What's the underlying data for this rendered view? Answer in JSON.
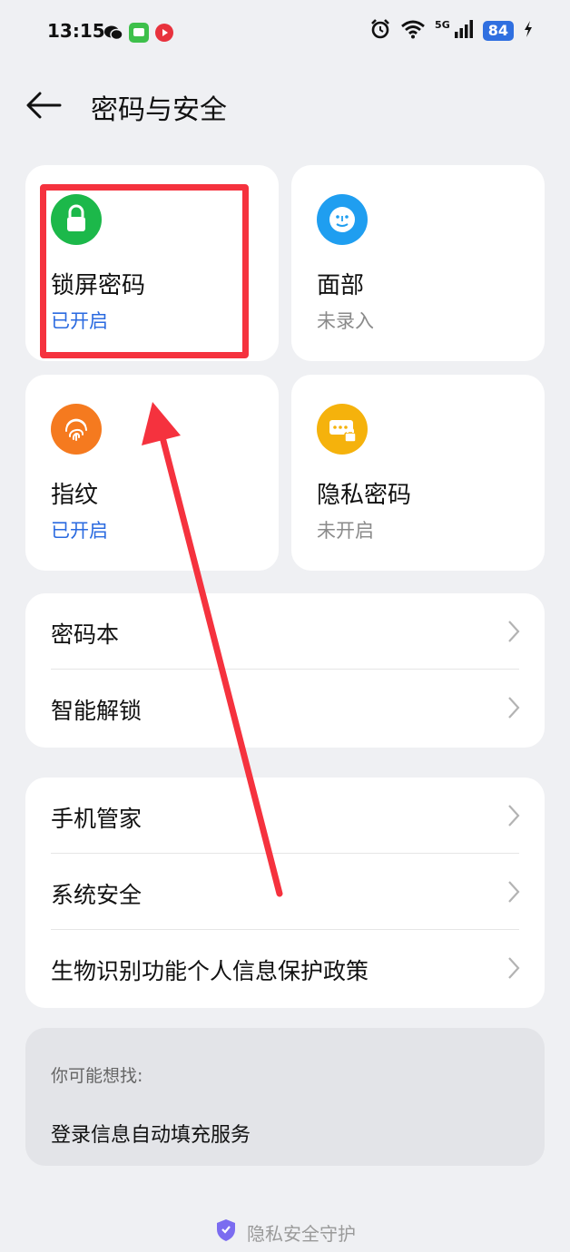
{
  "status_bar": {
    "time": "13:15",
    "network": "5G",
    "battery": "84"
  },
  "header": {
    "title": "密码与安全"
  },
  "tiles": [
    {
      "title": "锁屏密码",
      "status": "已开启",
      "icon": "lock-icon",
      "color": "#1cb84a"
    },
    {
      "title": "面部",
      "status": "未录入",
      "icon": "face-icon",
      "color": "#1f9ef0"
    },
    {
      "title": "指纹",
      "status": "已开启",
      "icon": "fingerprint-icon",
      "color": "#f57a1f"
    },
    {
      "title": "隐私密码",
      "status": "未开启",
      "icon": "privacy-password-icon",
      "color": "#f5b20c"
    }
  ],
  "group1": [
    "密码本",
    "智能解锁"
  ],
  "group2": [
    "手机管家",
    "系统安全",
    "生物识别功能个人信息保护政策"
  ],
  "suggest": {
    "title": "你可能想找:",
    "item": "登录信息自动填充服务"
  },
  "footer": {
    "text": "隐私安全守护"
  },
  "colors": {
    "accent": "#2a6ae0",
    "annotation": "#f5323e"
  }
}
